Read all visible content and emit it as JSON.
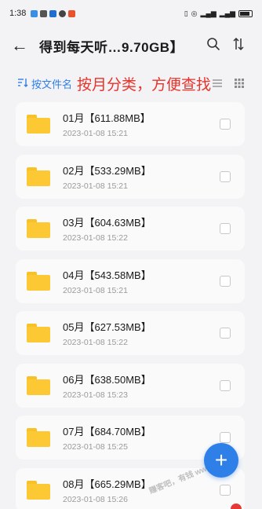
{
  "status": {
    "time": "1:38"
  },
  "header": {
    "title": "得到每天听…9.70GB】"
  },
  "toolbar": {
    "sort_label": "按文件名",
    "annotation": "按月分类，方便查找"
  },
  "folders": [
    {
      "name": "01月【611.88MB】",
      "date": "2023-01-08 15:21"
    },
    {
      "name": "02月【533.29MB】",
      "date": "2023-01-08 15:21"
    },
    {
      "name": "03月【604.63MB】",
      "date": "2023-01-08 15:22"
    },
    {
      "name": "04月【543.58MB】",
      "date": "2023-01-08 15:21"
    },
    {
      "name": "05月【627.53MB】",
      "date": "2023-01-08 15:22"
    },
    {
      "name": "06月【638.50MB】",
      "date": "2023-01-08 15:23"
    },
    {
      "name": "07月【684.70MB】",
      "date": "2023-01-08 15:25"
    },
    {
      "name": "08月【665.29MB】",
      "date": "2023-01-08 15:26"
    }
  ],
  "fab": {
    "label": "+"
  },
  "watermark": "赚客吧，有钱 www.zuan"
}
